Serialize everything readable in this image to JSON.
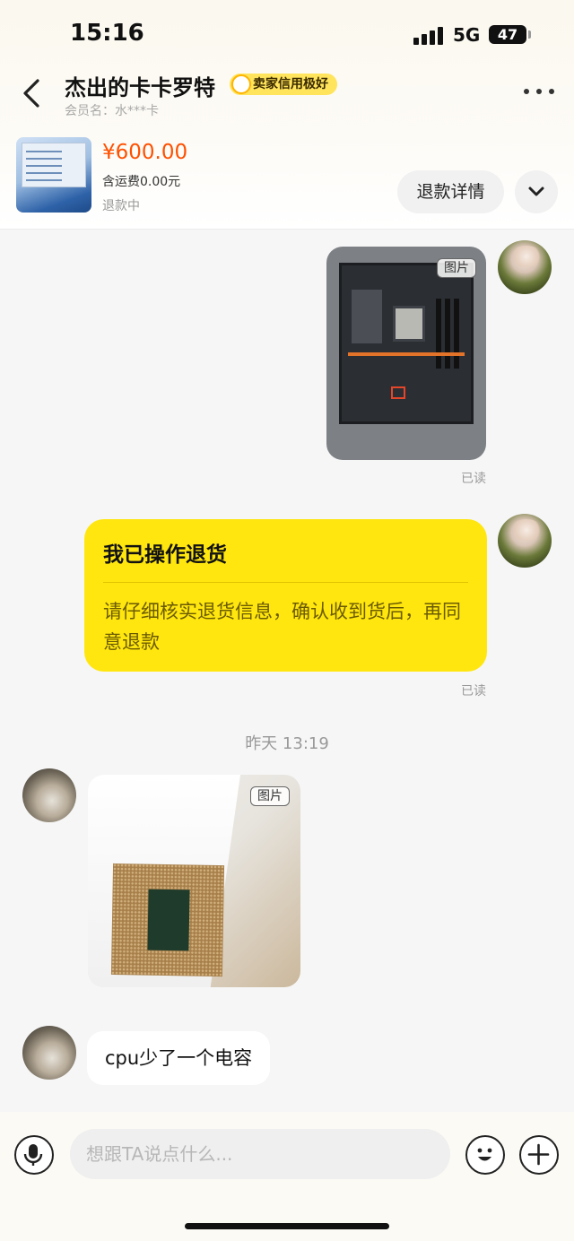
{
  "status_bar": {
    "time": "15:16",
    "network": "5G",
    "battery": "47"
  },
  "header": {
    "seller_name": "杰出的卡卡罗特",
    "credit_badge": "卖家信用极好",
    "member_name": "会员名：水***卡"
  },
  "product": {
    "price": "¥600.00",
    "shipping": "含运费0.00元",
    "status": "退款中",
    "refund_detail_label": "退款详情"
  },
  "messages": {
    "image_label": "图片",
    "read_mark": "已读",
    "return_card": {
      "title": "我已操作退货",
      "body": "请仔细核实退货信息，确认收到货后，再同意退款"
    },
    "timestamp": "昨天 13:19",
    "seller_text": "cpu少了一个电容"
  },
  "input": {
    "placeholder": "想跟TA说点什么..."
  },
  "colors": {
    "accent_yellow": "#ffe60f",
    "price_orange": "#ff5000"
  },
  "icons": [
    "chevron-left-icon",
    "more-dots-icon",
    "chevron-down-icon",
    "microphone-icon",
    "emoji-icon",
    "plus-icon"
  ]
}
